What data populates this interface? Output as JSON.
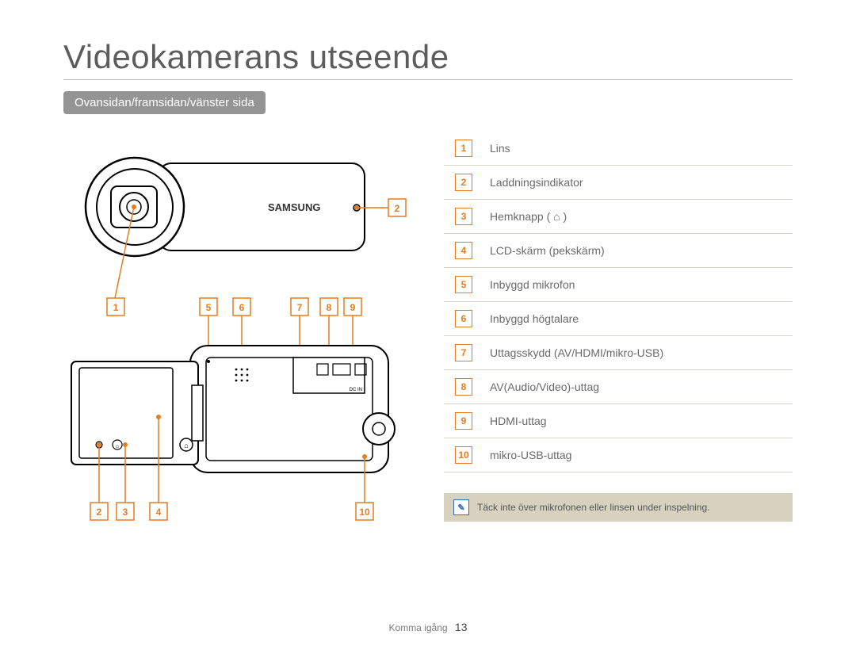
{
  "page": {
    "title": "Videokamerans utseende",
    "subheading": "Ovansidan/framsidan/vänster sida",
    "footer_section": "Komma igång",
    "page_number": "13"
  },
  "brand_on_device": "SAMSUNG",
  "dc_label": "DC IN",
  "legend": [
    {
      "n": "1",
      "label": "Lins"
    },
    {
      "n": "2",
      "label": "Laddningsindikator"
    },
    {
      "n": "3",
      "label": "Hemknapp ( ⌂ )"
    },
    {
      "n": "4",
      "label": "LCD-skärm (pekskärm)"
    },
    {
      "n": "5",
      "label": "Inbyggd mikrofon"
    },
    {
      "n": "6",
      "label": "Inbyggd högtalare"
    },
    {
      "n": "7",
      "label": "Uttagsskydd (AV/HDMI/mikro-USB)"
    },
    {
      "n": "8",
      "label": "AV(Audio/Video)-uttag"
    },
    {
      "n": "9",
      "label": "HDMI-uttag"
    },
    {
      "n": "10",
      "label": "mikro-USB-uttag"
    }
  ],
  "note": {
    "icon_glyph": "✎",
    "text": "Täck inte över mikrofonen eller linsen under inspelning."
  },
  "callouts": {
    "top_view": [
      "1",
      "2"
    ],
    "side_top": [
      "5",
      "6",
      "7",
      "8",
      "9"
    ],
    "side_bottom": [
      "2",
      "3",
      "4",
      "10"
    ]
  },
  "colors": {
    "accent": "#e67b1f",
    "subheading_bg": "#949494",
    "note_bg": "#d6d2bf",
    "note_icon": "#3b6bbf"
  }
}
